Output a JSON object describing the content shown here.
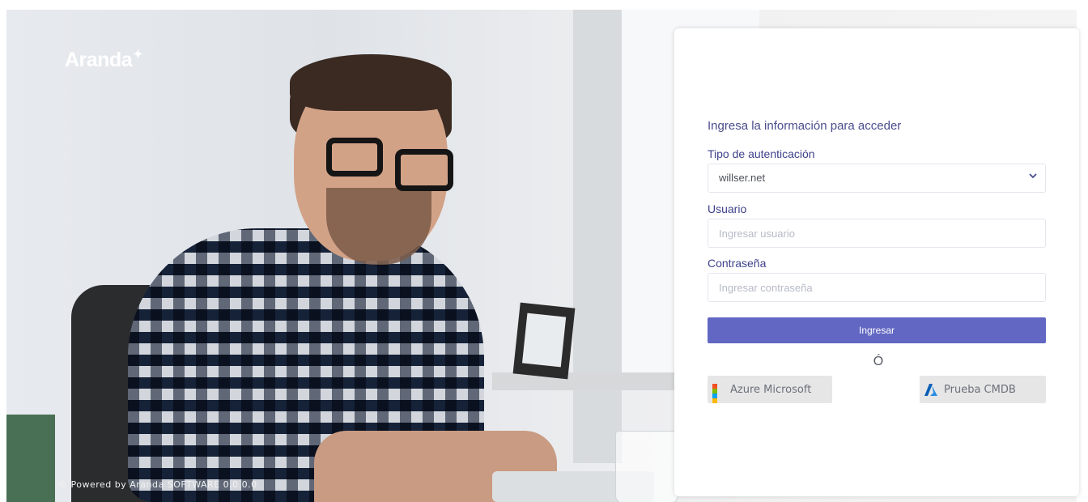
{
  "brand": {
    "logo_text": "Aranda",
    "logo_mark": "ꜜ̈",
    "footer": "© Powered by Aranda SOFTWARE 0.0.0.0"
  },
  "login": {
    "heading": "Ingresa la información para acceder",
    "auth_type": {
      "label": "Tipo de autenticación",
      "selected": "willser.net"
    },
    "username": {
      "label": "Usuario",
      "placeholder": "Ingresar usuario",
      "value": ""
    },
    "password": {
      "label": "Contraseña",
      "placeholder": "Ingresar contraseña",
      "value": ""
    },
    "submit_label": "Ingresar",
    "or_text": "Ó",
    "sso": [
      {
        "label": "Azure Microsoft",
        "icon": "microsoft-logo-icon"
      },
      {
        "label": "Prueba CMDB",
        "icon": "azure-logo-icon"
      }
    ]
  },
  "colors": {
    "primary": "#6167c2",
    "label": "#3f428c",
    "ms_red": "#f25022",
    "ms_green": "#7fba00",
    "ms_blue": "#00a4ef",
    "ms_yellow": "#ffb900",
    "azure_blue": "#0078d4"
  }
}
